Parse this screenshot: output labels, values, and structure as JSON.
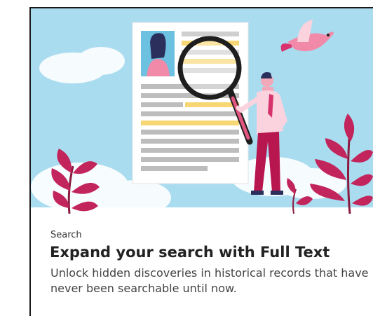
{
  "card": {
    "eyebrow": "Search",
    "title": "Expand your search with Full Text",
    "description": "Unlock hidden discoveries in historical records that have never been searchable until now."
  },
  "illustration": {
    "sky_color": "#a9dcef",
    "accent_color": "#d6336c",
    "highlight_color": "#f7d774",
    "icons": [
      "document-icon",
      "magnifying-glass-icon",
      "person-icon",
      "bird-icon",
      "plant-icon"
    ]
  }
}
